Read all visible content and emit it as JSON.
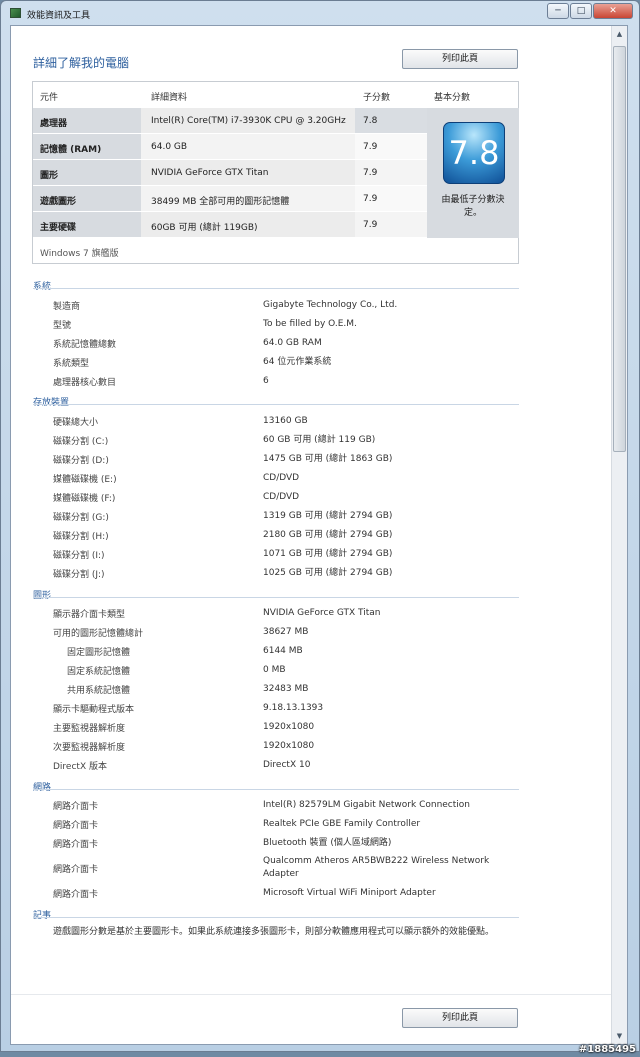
{
  "window": {
    "title": "效能資訊及工具",
    "min": "─",
    "max": "□",
    "close": "✕"
  },
  "header": {
    "title": "詳細了解我的電腦",
    "print_label": "列印此頁"
  },
  "rating": {
    "columns": [
      "元件",
      "詳細資料",
      "子分數",
      "基本分數"
    ],
    "rows": [
      {
        "component": "處理器",
        "detail": "Intel(R) Core(TM) i7-3930K CPU @ 3.20GHz",
        "score": "7.8"
      },
      {
        "component": "記憶體 (RAM)",
        "detail": "64.0 GB",
        "score": "7.9"
      },
      {
        "component": "圖形",
        "detail": "NVIDIA GeForce GTX Titan",
        "score": "7.9"
      },
      {
        "component": "遊戲圖形",
        "detail": "38499 MB 全部可用的圖形記憶體",
        "score": "7.9"
      },
      {
        "component": "主要硬碟",
        "detail": "60GB 可用 (總計 119GB)",
        "score": "7.9"
      }
    ],
    "base_score": "7.8",
    "base_note": "由最低子分數決定。",
    "edition": "Windows 7 旗艦版"
  },
  "sections": {
    "system": {
      "title": "系統",
      "items": [
        {
          "label": "製造商",
          "value": "Gigabyte Technology Co., Ltd."
        },
        {
          "label": "型號",
          "value": "To be filled by O.E.M."
        },
        {
          "label": "系統記憶體總數",
          "value": "64.0 GB RAM"
        },
        {
          "label": "系統類型",
          "value": "64 位元作業系統"
        },
        {
          "label": "處理器核心數目",
          "value": "6"
        }
      ]
    },
    "storage": {
      "title": "存放裝置",
      "items": [
        {
          "label": "硬碟總大小",
          "value": "13160 GB"
        },
        {
          "label": "磁碟分割 (C:)",
          "value": "60 GB 可用 (總計 119 GB)"
        },
        {
          "label": "磁碟分割 (D:)",
          "value": "1475 GB 可用 (總計 1863 GB)"
        },
        {
          "label": "媒體磁碟機 (E:)",
          "value": "CD/DVD"
        },
        {
          "label": "媒體磁碟機 (F:)",
          "value": "CD/DVD"
        },
        {
          "label": "磁碟分割 (G:)",
          "value": "1319 GB 可用 (總計 2794 GB)"
        },
        {
          "label": "磁碟分割 (H:)",
          "value": "2180 GB 可用 (總計 2794 GB)"
        },
        {
          "label": "磁碟分割 (I:)",
          "value": "1071 GB 可用 (總計 2794 GB)"
        },
        {
          "label": "磁碟分割 (J:)",
          "value": "1025 GB 可用 (總計 2794 GB)"
        }
      ]
    },
    "graphics": {
      "title": "圖形",
      "items": [
        {
          "label": "顯示器介面卡類型",
          "value": "NVIDIA GeForce GTX Titan"
        },
        {
          "label": "可用的圖形記憶體總計",
          "value": "38627 MB"
        },
        {
          "label": "固定圖形記憶體",
          "value": "6144 MB"
        },
        {
          "label": "固定系統記憶體",
          "value": "0 MB"
        },
        {
          "label": "共用系統記憶體",
          "value": "32483 MB"
        },
        {
          "label": "顯示卡驅動程式版本",
          "value": "9.18.13.1393"
        },
        {
          "label": "主要監視器解析度",
          "value": "1920x1080"
        },
        {
          "label": "次要監視器解析度",
          "value": "1920x1080"
        },
        {
          "label": "DirectX 版本",
          "value": "DirectX 10"
        }
      ]
    },
    "network": {
      "title": "網路",
      "items": [
        {
          "label": "網路介面卡",
          "value": "Intel(R) 82579LM Gigabit Network Connection"
        },
        {
          "label": "網路介面卡",
          "value": "Realtek PCIe GBE Family Controller"
        },
        {
          "label": "網路介面卡",
          "value": "Bluetooth 裝置 (個人區域網路)"
        },
        {
          "label": "網路介面卡",
          "value": "Qualcomm Atheros AR5BWB222 Wireless Network Adapter"
        },
        {
          "label": "網路介面卡",
          "value": "Microsoft Virtual WiFi Miniport Adapter"
        }
      ]
    },
    "notes": {
      "title": "記事",
      "text": "遊戲圖形分數是基於主要圖形卡。如果此系統連接多張圖形卡，則部分軟體應用程式可以顯示額外的效能優點。"
    }
  },
  "watermark": "#1885495"
}
